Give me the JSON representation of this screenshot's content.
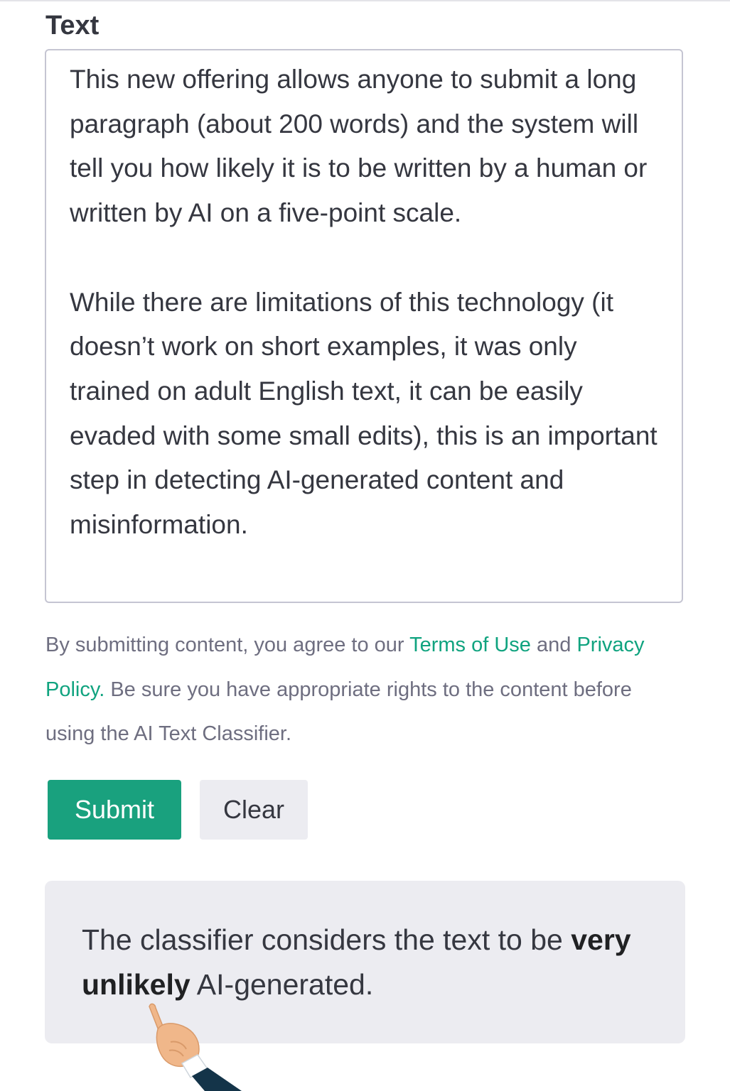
{
  "form": {
    "field_label": "Text",
    "textarea_paragraphs": [
      "This new offering allows anyone to submit a long paragraph (about 200 words) and the system will tell you how likely it is to be written by a human or written by AI on a five-point scale.",
      "While there are limitations of this technology (it doesn’t work on short examples, it was only trained on adult English text, it can be easily evaded with some small edits), this is an important step in detecting AI-generated content and misinformation."
    ]
  },
  "disclaimer": {
    "prefix": "By submitting content, you agree to our ",
    "terms_link": "Terms of Use",
    "and_text": " and ",
    "privacy_link": "Privacy Policy.",
    "suffix": " Be sure you have appropriate rights to the content before using the AI Text Classifier."
  },
  "actions": {
    "submit_label": "Submit",
    "clear_label": "Clear"
  },
  "result": {
    "prefix": "The classifier considers the text to be ",
    "verdict": "very unlikely",
    "suffix": " AI-generated."
  },
  "colors": {
    "accent": "#10a37f",
    "submit_bg": "#19a17e",
    "panel_bg": "#ececf1",
    "text": "#353740",
    "muted_text": "#6e6e80",
    "border": "#c5c5d2"
  },
  "icons": {
    "pointer": "pointing-hand-icon"
  }
}
